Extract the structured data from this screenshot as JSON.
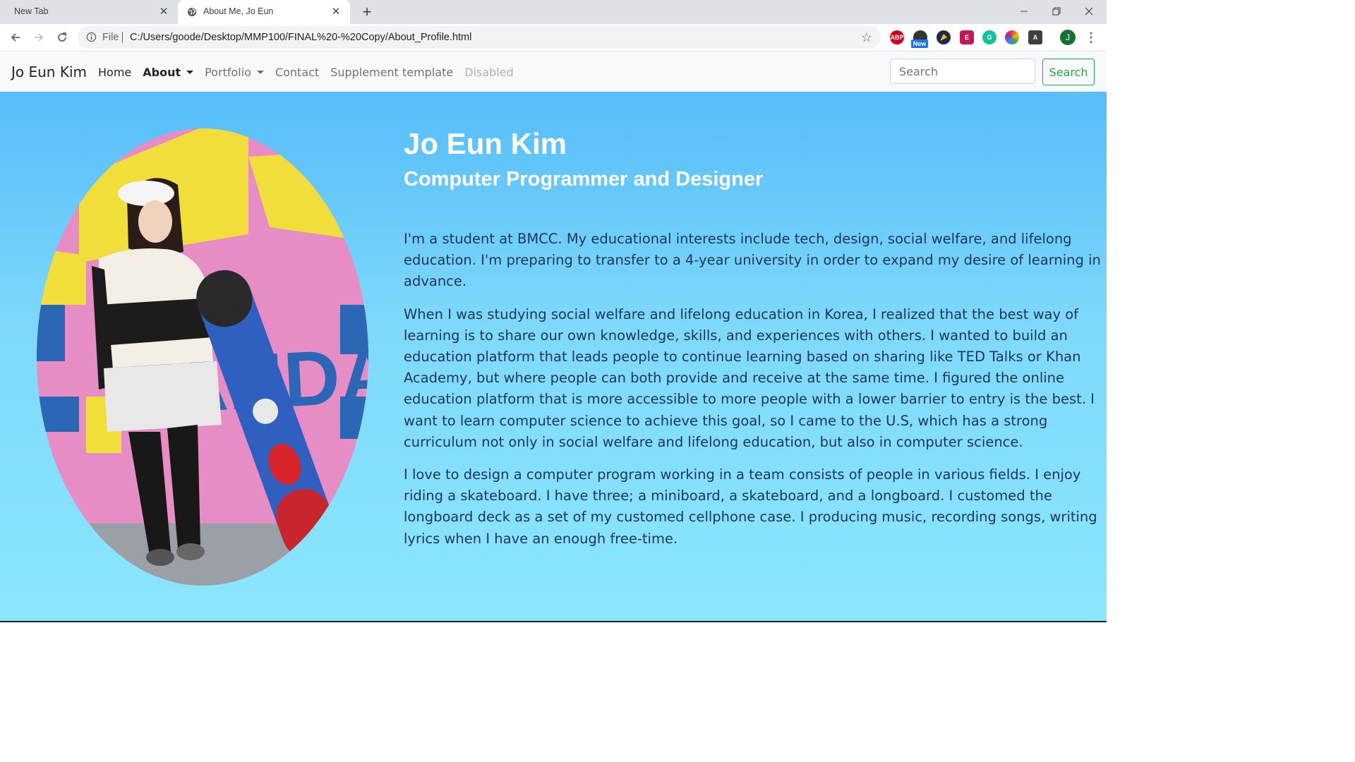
{
  "browser": {
    "tabs": [
      {
        "title": "New Tab",
        "active": false
      },
      {
        "title": "About Me, Jo Eun",
        "active": true
      }
    ],
    "address": {
      "scheme": "File",
      "url": "C:/Users/goode/Desktop/MMP100/FINAL%20-%20Copy/About_Profile.html"
    },
    "extensions": [
      {
        "name": "adblock-plus-icon",
        "label": "ABP",
        "color": "#d0021b"
      },
      {
        "name": "new-extension-icon",
        "label": "",
        "color": "#333333"
      },
      {
        "name": "compass-extension-icon",
        "label": "",
        "color": "#1d2a4d"
      },
      {
        "name": "e-extension-icon",
        "label": "E",
        "color": "#c2185b"
      },
      {
        "name": "grammarly-icon",
        "label": "G",
        "color": "#15c39a"
      },
      {
        "name": "color-wheel-icon",
        "label": "",
        "color": "#f4b400"
      },
      {
        "name": "font-extension-icon",
        "label": "A",
        "color": "#3c4043"
      }
    ],
    "new_badge": "New",
    "profile_initial": "J"
  },
  "navbar": {
    "brand": "Jo Eun Kim",
    "links": {
      "home": "Home",
      "about": "About",
      "portfolio": "Portfolio",
      "contact": "Contact",
      "supplement": "Supplement template",
      "disabled": "Disabled"
    },
    "search_placeholder": "Search",
    "search_button": "Search"
  },
  "profile": {
    "name": "Jo Eun Kim",
    "title": "Computer Programmer and Designer",
    "paragraphs": [
      "I'm a student at BMCC. My educational interests include tech, design, social welfare, and lifelong education. I'm preparing to transfer to a 4-year university in order to expand my desire of learning in advance.",
      "When I was studying social welfare and lifelong education in Korea, I realized that the best way of learning is to share our own knowledge, skills, and experiences with others. I wanted to build an education platform that leads people to continue learning based on sharing like TED Talks or Khan Academy, but where people can both provide and receive at the same time. I figured the online education platform that is more accessible to more people with a lower barrier to entry is the best. I want to learn computer science to achieve this goal, so I came to the U.S, which has a strong curriculum not only in social welfare and lifelong education, but also in computer science.",
      "I love to design a computer program working in a team consists of people in various fields. I enjoy riding a skateboard. I have three; a miniboard, a skateboard, and a longboard. I customed the longboard deck as a set of my customed cellphone case. I producing music, recording songs, writing lyrics when I have an enough free-time."
    ],
    "portrait_wall_text": "FANDA"
  },
  "colors": {
    "hero_top": "#56bdf9",
    "hero_bottom": "#8be6fd",
    "accent_green": "#28a745",
    "text_dark": "#1d3557"
  }
}
